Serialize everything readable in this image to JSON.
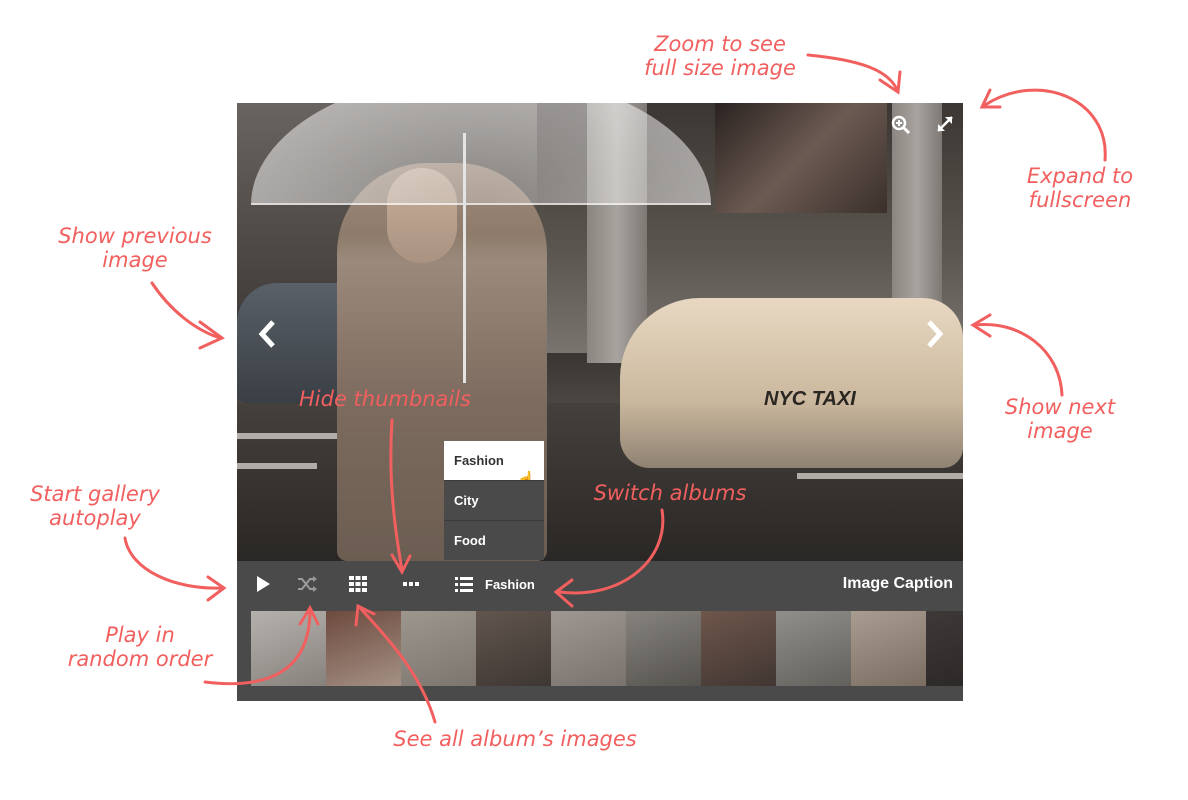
{
  "gallery": {
    "caption": "Image Caption",
    "current_album": "Fashion",
    "albums": [
      {
        "label": "Fashion",
        "active": true
      },
      {
        "label": "City",
        "active": false
      },
      {
        "label": "Food",
        "active": false
      }
    ],
    "photo": {
      "taxi_text": "NYC TAXI"
    },
    "icons": {
      "prev": "chevron-left-icon",
      "next": "chevron-right-icon",
      "zoom": "zoom-in-icon",
      "fullscreen": "expand-icon",
      "play": "play-icon",
      "shuffle": "shuffle-icon",
      "grid": "grid-icon",
      "hide_thumbs": "ellipsis-icon",
      "albums": "list-icon"
    },
    "thumbnails": [
      {
        "colors": [
          "#d8d4cf",
          "#9c948c"
        ]
      },
      {
        "colors": [
          "#7a4a3a",
          "#c2a898"
        ]
      },
      {
        "colors": [
          "#b8b0a6",
          "#8c847a"
        ]
      },
      {
        "colors": [
          "#6a5a50",
          "#3a302b"
        ]
      },
      {
        "colors": [
          "#bab2aa",
          "#8a8078"
        ]
      },
      {
        "colors": [
          "#9a9690",
          "#5a5650"
        ]
      },
      {
        "colors": [
          "#7a5a4c",
          "#3e302a"
        ]
      },
      {
        "colors": [
          "#a8a6a0",
          "#6a6862"
        ]
      },
      {
        "colors": [
          "#c8b8a8",
          "#8a7868"
        ]
      },
      {
        "colors": [
          "#3a3432",
          "#1e1a18"
        ]
      }
    ]
  },
  "annotations": {
    "zoom": "Zoom to see\nfull size image",
    "expand": "Expand to\nfullscreen",
    "previous": "Show previous\nimage",
    "next": "Show next\nimage",
    "hide_thumbs": "Hide thumbnails",
    "switch_albums": "Switch albums",
    "autoplay": "Start gallery\nautoplay",
    "random": "Play in\nrandom order",
    "all_images": "See all album’s images"
  },
  "colors": {
    "annotation": "#f25f5f",
    "bar": "#4a4a4a"
  }
}
